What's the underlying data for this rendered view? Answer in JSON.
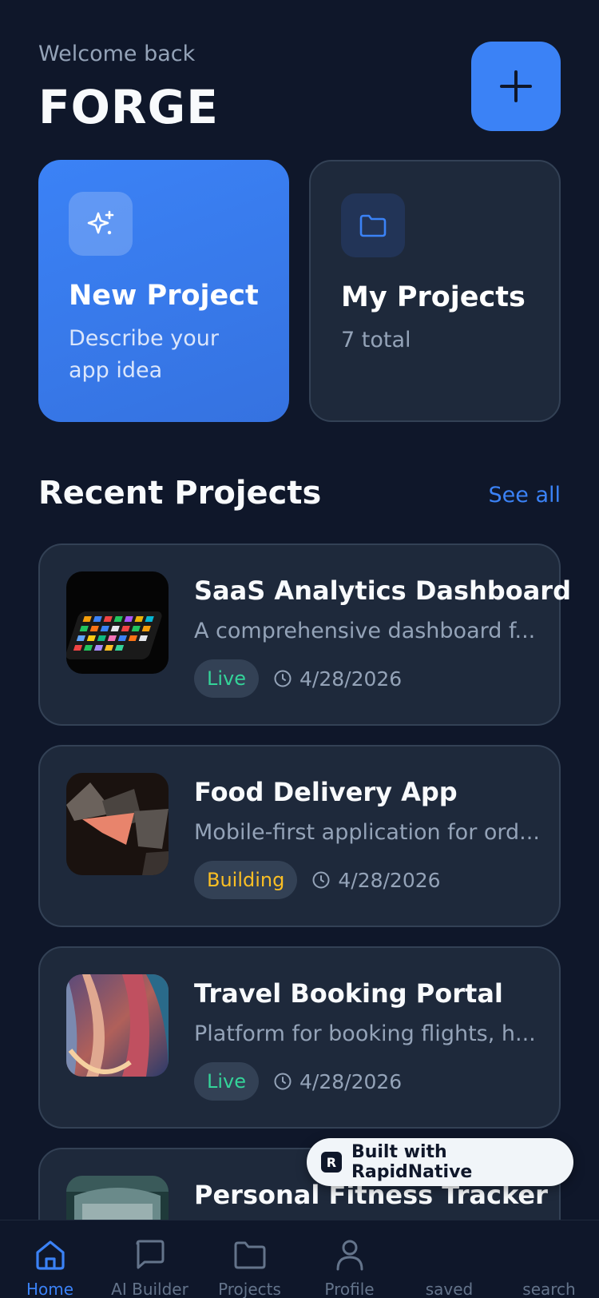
{
  "header": {
    "welcome": "Welcome back",
    "brand": "FORGE"
  },
  "quick_cards": {
    "new_project": {
      "title": "New Project",
      "subtitle_line1": "Describe your",
      "subtitle_line2": "app idea",
      "icon": "sparkles-icon"
    },
    "my_projects": {
      "title": "My Projects",
      "subtitle": "7 total",
      "icon": "folder-icon"
    }
  },
  "recent": {
    "title": "Recent Projects",
    "see_all": "See all",
    "projects": [
      {
        "title": "SaaS Analytics Dashboard",
        "description": "A comprehensive dashboard f...",
        "status": "Live",
        "date": "4/28/2026"
      },
      {
        "title": "Food Delivery App",
        "description": "Mobile-first application for ord...",
        "status": "Building",
        "date": "4/28/2026"
      },
      {
        "title": "Travel Booking Portal",
        "description": "Platform for booking flights, h...",
        "status": "Live",
        "date": "4/28/2026"
      },
      {
        "title": "Personal Fitness Tracker"
      }
    ]
  },
  "badge": {
    "text": "Built with RapidNative"
  },
  "tabs": [
    {
      "label": "Home",
      "icon": "home-icon",
      "active": true
    },
    {
      "label": "AI Builder",
      "icon": "chat-icon"
    },
    {
      "label": "Projects",
      "icon": "folder-icon"
    },
    {
      "label": "Profile",
      "icon": "user-icon"
    },
    {
      "label": "saved"
    },
    {
      "label": "search"
    }
  ],
  "colors": {
    "background": "#0f172a",
    "card": "#1e293b",
    "accent": "#3b82f6",
    "live": "#34d399",
    "building": "#fbbf24"
  }
}
